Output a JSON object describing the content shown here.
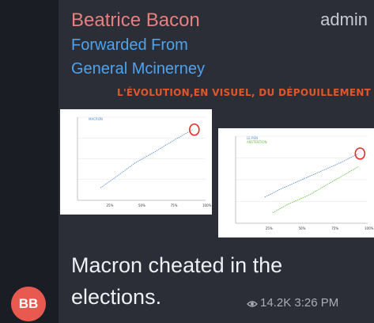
{
  "message": {
    "sender": "Beatrice Bacon",
    "role": "admin",
    "forwarded_line1": "Forwarded From",
    "forwarded_line2": "General Mcinerney",
    "image_caption": "L'ÉVOLUTION,EN VISUEL, DU DÉPOUILLEMENT",
    "text_line1": "Macron cheated in the",
    "text_line2": "elections.",
    "views": "14.2K",
    "time": "3:26 PM",
    "avatar_initials": "BB"
  },
  "colors": {
    "sender": "#ea7f7f",
    "link": "#4ea3f0",
    "caption": "#e2562a",
    "avatar": "#e85a4f",
    "circle_marker": "#e0302a"
  },
  "chart_data": [
    {
      "type": "line",
      "title": "",
      "legend": [
        "MACRON"
      ],
      "x_ticks": [
        "25%",
        "50%",
        "75%",
        "100%"
      ],
      "series": [
        {
          "name": "MACRON",
          "color": "#5b8fd0",
          "x": [
            0.18,
            0.3,
            0.45,
            0.6,
            0.75,
            0.9
          ],
          "y": [
            0.15,
            0.28,
            0.45,
            0.58,
            0.72,
            0.85
          ]
        }
      ]
    },
    {
      "type": "line",
      "title": "",
      "legend": [
        "LE PEN",
        "ABSTENTION"
      ],
      "x_ticks": [
        "25%",
        "50%",
        "75%",
        "100%"
      ],
      "series": [
        {
          "name": "LE PEN",
          "color": "#5b8fd0",
          "x": [
            0.22,
            0.35,
            0.5,
            0.65,
            0.8,
            0.93
          ],
          "y": [
            0.3,
            0.4,
            0.5,
            0.6,
            0.7,
            0.8
          ]
        },
        {
          "name": "ABSTENTION",
          "color": "#6cc04a",
          "x": [
            0.28,
            0.4,
            0.55,
            0.7,
            0.85,
            0.93
          ],
          "y": [
            0.12,
            0.22,
            0.32,
            0.45,
            0.58,
            0.65
          ]
        }
      ]
    }
  ]
}
